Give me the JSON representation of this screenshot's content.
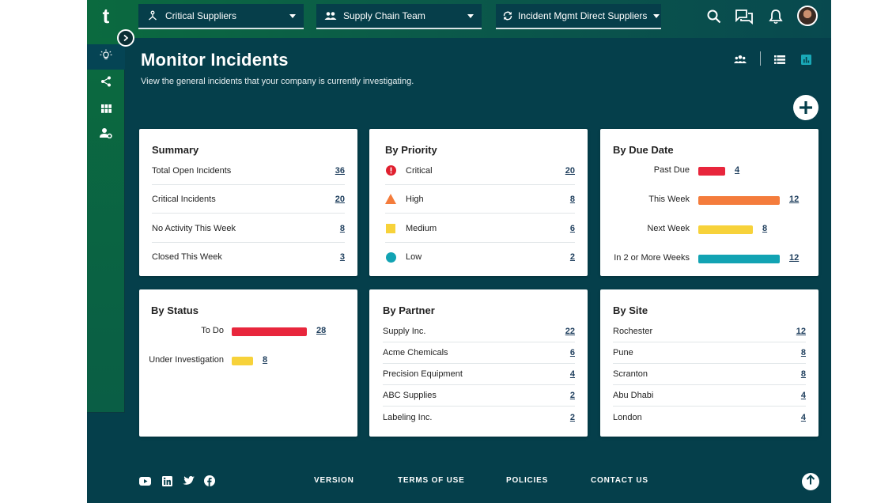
{
  "app": {
    "logo": "t"
  },
  "header": {
    "selectors": [
      {
        "label": "Critical Suppliers",
        "icon": "hierarchy-icon"
      },
      {
        "label": "Supply Chain Team",
        "icon": "team-icon"
      },
      {
        "label": "Incident Mgmt Direct Suppliers",
        "icon": "sync-icon"
      }
    ],
    "icons": [
      "search-icon",
      "chat-icon",
      "bell-icon",
      "avatar"
    ]
  },
  "sidebar": {
    "items": [
      "lightbulb-icon",
      "share-icon",
      "grid-icon",
      "user-settings-icon"
    ]
  },
  "page": {
    "title": "Monitor Incidents",
    "subtitle": "View the general incidents that your company is currently investigating."
  },
  "summary": {
    "title": "Summary",
    "rows": [
      {
        "label": "Total Open Incidents",
        "value": "36"
      },
      {
        "label": "Critical Incidents",
        "value": "20"
      },
      {
        "label": "No Activity This Week",
        "value": "8"
      },
      {
        "label": "Closed This Week",
        "value": "3"
      }
    ]
  },
  "priority": {
    "title": "By Priority",
    "rows": [
      {
        "label": "Critical",
        "value": "20",
        "icon": "critical-icon",
        "color": "#e0202f"
      },
      {
        "label": "High",
        "value": "8",
        "icon": "high-icon",
        "color": "#f47c3c"
      },
      {
        "label": "Medium",
        "value": "6",
        "icon": "medium-icon",
        "color": "#f7d23a"
      },
      {
        "label": "Low",
        "value": "2",
        "icon": "low-icon",
        "color": "#12a3b3"
      }
    ]
  },
  "due": {
    "title": "By Due Date",
    "rows": [
      {
        "label": "Past Due",
        "value": "4",
        "count": 4,
        "color": "#e8263c"
      },
      {
        "label": "This Week",
        "value": "12",
        "count": 12,
        "color": "#f47c3c"
      },
      {
        "label": "Next Week",
        "value": "8",
        "count": 8,
        "color": "#f7d23a"
      },
      {
        "label": "In 2 or More Weeks",
        "value": "12",
        "count": 12,
        "color": "#12a3b3"
      }
    ]
  },
  "status": {
    "title": "By Status",
    "rows": [
      {
        "label": "To Do",
        "value": "28",
        "count": 28,
        "color": "#e8263c"
      },
      {
        "label": "Under Investigation",
        "value": "8",
        "count": 8,
        "color": "#f7d23a"
      }
    ]
  },
  "partner": {
    "title": "By Partner",
    "rows": [
      {
        "label": "Supply Inc.",
        "value": "22"
      },
      {
        "label": "Acme Chemicals",
        "value": "6"
      },
      {
        "label": "Precision Equipment",
        "value": "4"
      },
      {
        "label": "ABC Supplies",
        "value": "2"
      },
      {
        "label": "Labeling Inc.",
        "value": "2"
      }
    ]
  },
  "site": {
    "title": "By Site",
    "rows": [
      {
        "label": "Rochester",
        "value": "12"
      },
      {
        "label": "Pune",
        "value": "8"
      },
      {
        "label": "Scranton",
        "value": "8"
      },
      {
        "label": "Abu Dhabi",
        "value": "4"
      },
      {
        "label": "London",
        "value": "4"
      }
    ]
  },
  "footer": {
    "social": [
      "youtube-icon",
      "linkedin-icon",
      "twitter-icon",
      "facebook-icon"
    ],
    "links": [
      "VERSION",
      "TERMS OF USE",
      "POLICIES",
      "CONTACT US"
    ]
  }
}
